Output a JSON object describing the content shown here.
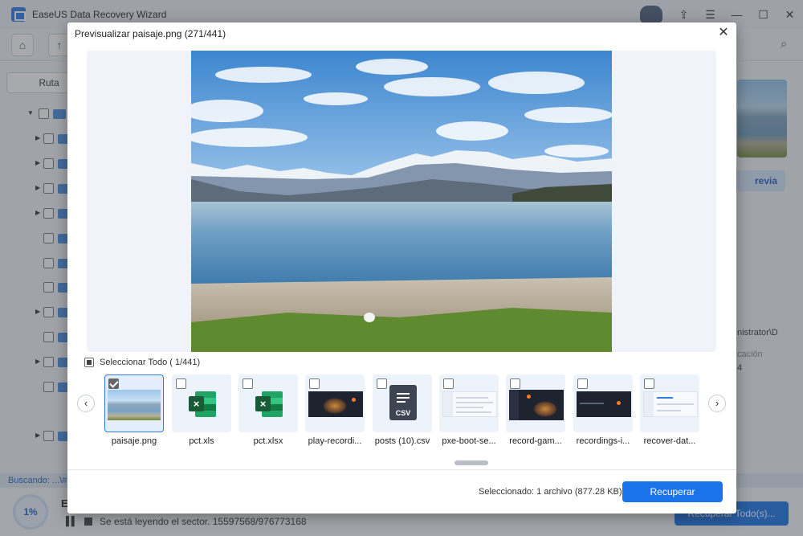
{
  "app": {
    "title": "EaseUS Data Recovery Wizard",
    "ruta_tab": "Ruta",
    "vista_previa_fragment": "revia",
    "side_path_fragment": "nistrator\\D",
    "side_label_fragment": "cación",
    "side_value_fragment": "4",
    "status_text": "Buscando: ...\\#",
    "progress_percent": "1%",
    "progress_letter": "E",
    "sector_text": "Se está leyendo el sector. 15597568/976773168",
    "recover_all_label": "Recuperar Todo(s)..."
  },
  "modal": {
    "title": "Previsualizar paisaje.png (271/441)",
    "close_symbol": "✕",
    "select_all_label": "Seleccionar Todo ( 1/441)",
    "prev_symbol": "‹",
    "next_symbol": "›",
    "selected_info": "Seleccionado: 1 archivo (877.28 KB)",
    "recover_label": "Recuperar",
    "thumbnails": [
      {
        "name": "paisaje.png",
        "kind": "photo",
        "checked": true
      },
      {
        "name": "pct.xls",
        "kind": "excel-icon",
        "checked": false
      },
      {
        "name": "pct.xlsx",
        "kind": "excel-icon",
        "checked": false
      },
      {
        "name": "play-recordi...",
        "kind": "dark-screenshot",
        "checked": false
      },
      {
        "name": "posts (10).csv",
        "kind": "csv-icon",
        "csv_label": "CSV",
        "checked": false
      },
      {
        "name": "pxe-boot-se...",
        "kind": "light-screenshot",
        "checked": false
      },
      {
        "name": "record-gam...",
        "kind": "dark-screenshot",
        "checked": false
      },
      {
        "name": "recordings-i...",
        "kind": "dark-screenshot",
        "checked": false
      },
      {
        "name": "recover-dat...",
        "kind": "light-screenshot",
        "checked": false
      }
    ]
  },
  "colors": {
    "accent": "#1a73e8",
    "selection_border": "#2f7be8",
    "status_text": "#1f5fc4"
  }
}
